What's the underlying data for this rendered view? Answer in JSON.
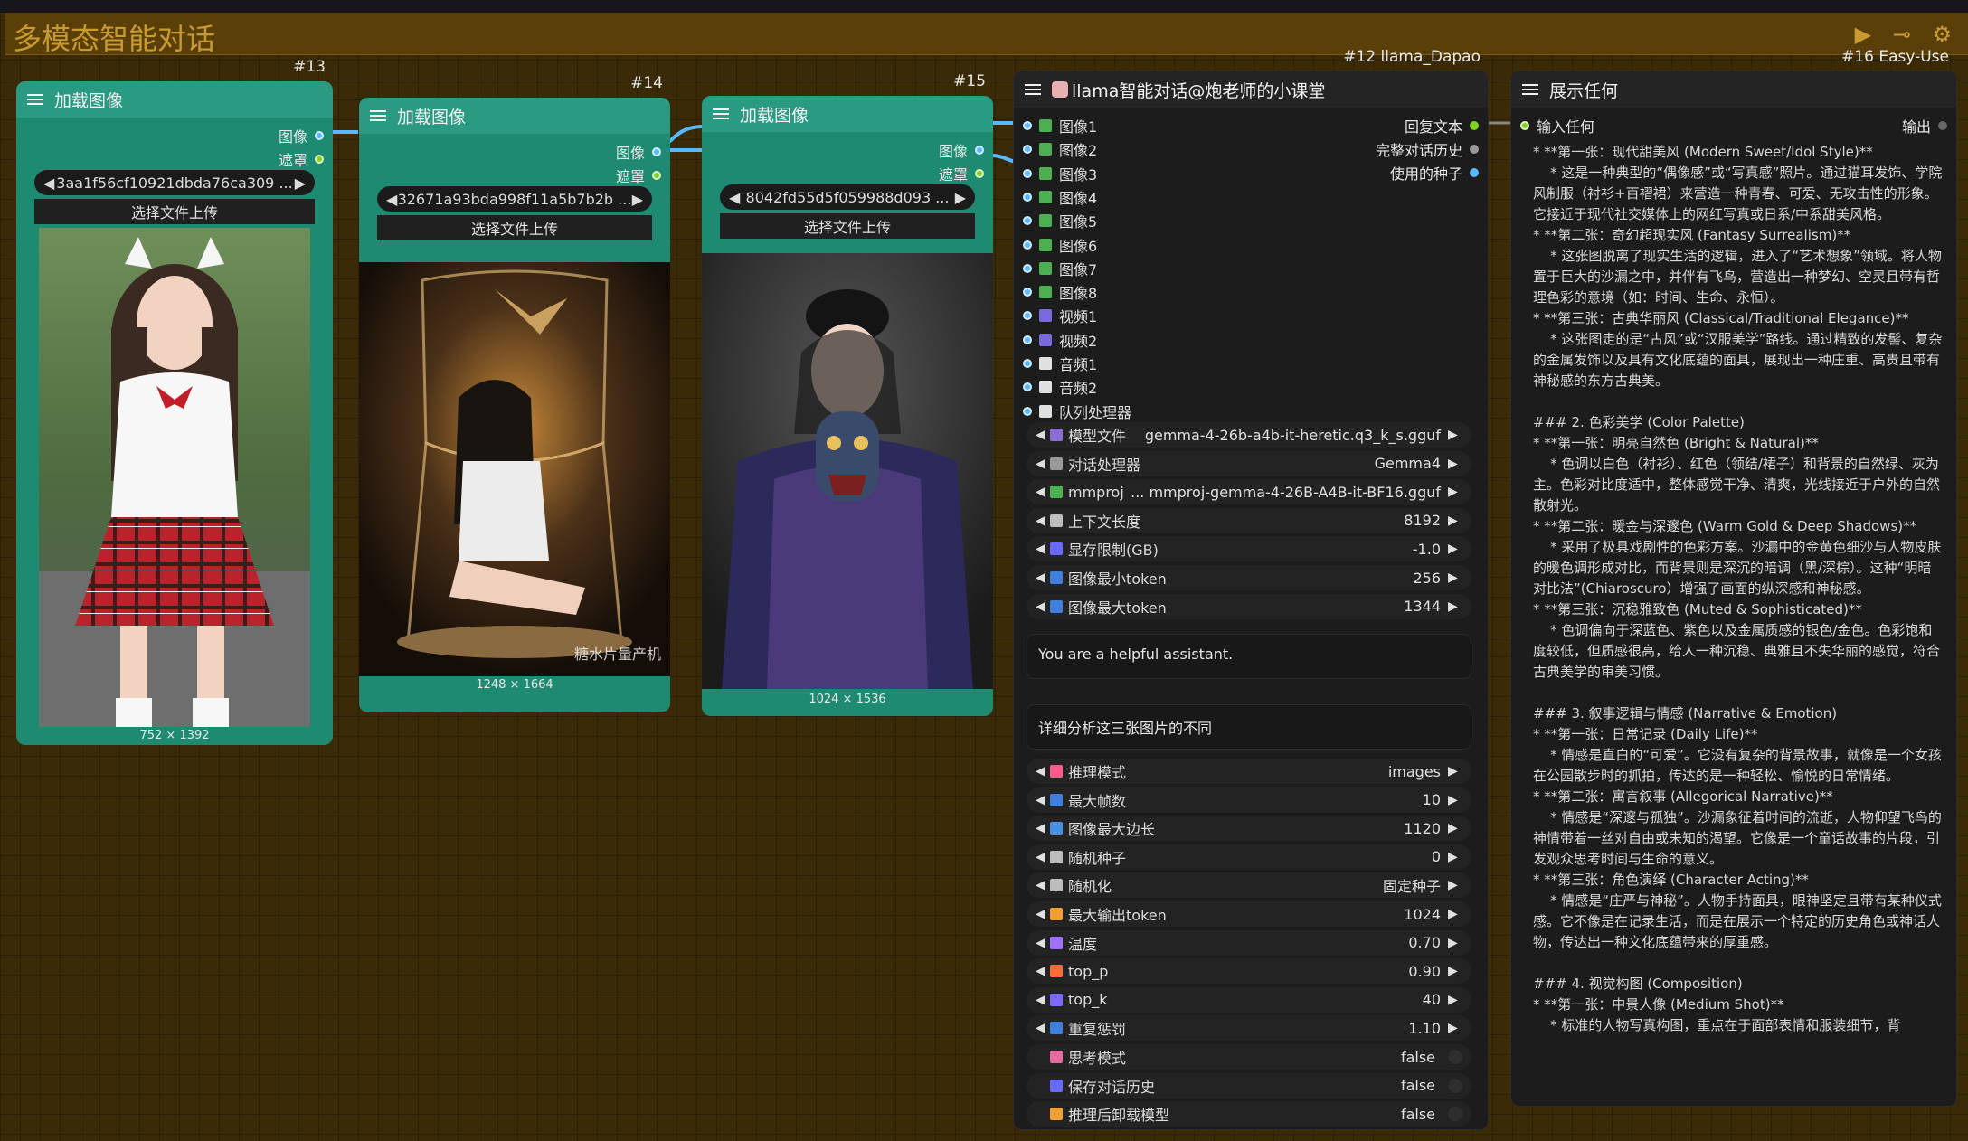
{
  "group": {
    "title": "多模态智能对话",
    "icons": "▶ ⊸ ⚙"
  },
  "load_nodes": [
    {
      "id": "#13",
      "title": "加载图像",
      "out_image": "图像",
      "out_mask": "遮罩",
      "file": "3aa1f56cf10921dbda76ca309 ...",
      "upload": "选择文件上传",
      "size": "752 × 1392"
    },
    {
      "id": "#14",
      "title": "加载图像",
      "out_image": "图像",
      "out_mask": "遮罩",
      "file": "32671a93bda998f11a5b7b2b ...",
      "upload": "选择文件上传",
      "size": "1248 × 1664",
      "watermark": "糖水片量产机"
    },
    {
      "id": "#15",
      "title": "加载图像",
      "out_image": "图像",
      "out_mask": "遮罩",
      "file": "8042fd55d5f059988d093 ...",
      "upload": "选择文件上传",
      "size": "1024 × 1536"
    }
  ],
  "llama": {
    "id": "#12 llama_Dapao",
    "title": "llama智能对话@炮老师的小课堂",
    "inputs": [
      "图像1",
      "图像2",
      "图像3",
      "图像4",
      "图像5",
      "图像6",
      "图像7",
      "图像8",
      "视频1",
      "视频2",
      "音频1",
      "音频2",
      "队列处理器"
    ],
    "outputs": [
      "回复文本",
      "完整对话历史",
      "使用的种子"
    ],
    "widgets_top": [
      {
        "label": "模型文件",
        "value": "gemma-4-26b-a4b-it-heretic.q3_k_s.gguf",
        "icon": "#8b6bd6"
      },
      {
        "label": "对话处理器",
        "value": "Gemma4",
        "icon": "#999999"
      },
      {
        "label": "mmproj",
        "value": "... mmproj-gemma-4-26B-A4B-it-BF16.gguf",
        "icon": "#4caf50"
      },
      {
        "label": "上下文长度",
        "value": "8192",
        "icon": "#bdbdbd"
      },
      {
        "label": "显存限制(GB)",
        "value": "-1.0",
        "icon": "#6a6aff"
      },
      {
        "label": "图像最小token",
        "value": "256",
        "icon": "#3f7fe0"
      },
      {
        "label": "图像最大token",
        "value": "1344",
        "icon": "#3f7fe0"
      }
    ],
    "system_prompt": "You are a helpful assistant.",
    "user_prompt": "详细分析这三张图片的不同",
    "widgets_bottom": [
      {
        "label": "推理模式",
        "value": "images",
        "icon": "#ff5a8a"
      },
      {
        "label": "最大帧数",
        "value": "10",
        "icon": "#3f7fe0"
      },
      {
        "label": "图像最大边长",
        "value": "1120",
        "icon": "#4a90e2"
      },
      {
        "label": "随机种子",
        "value": "0",
        "icon": "#bdbdbd"
      },
      {
        "label": "随机化",
        "value": "固定种子",
        "icon": "#bdbdbd"
      },
      {
        "label": "最大输出token",
        "value": "1024",
        "icon": "#f0a030"
      },
      {
        "label": "温度",
        "value": "0.70",
        "icon": "#a070ff"
      },
      {
        "label": "top_p",
        "value": "0.90",
        "icon": "#ff6a3a"
      },
      {
        "label": "top_k",
        "value": "40",
        "icon": "#7a6aff"
      },
      {
        "label": "重复惩罚",
        "value": "1.10",
        "icon": "#3f7fe0"
      }
    ],
    "toggles": [
      {
        "label": "思考模式",
        "value": "false",
        "icon": "#e86aa0"
      },
      {
        "label": "保存对话历史",
        "value": "false",
        "icon": "#6a6aff"
      },
      {
        "label": "推理后卸载模型",
        "value": "false",
        "icon": "#f0a030"
      }
    ]
  },
  "display": {
    "id": "#16 Easy-Use",
    "title": "展示任何",
    "input": "输入任何",
    "output": "输出",
    "text": "* **第一张：现代甜美风 (Modern Sweet/Idol Style)**\n    * 这是一种典型的“偶像感”或“写真感”照片。通过猫耳发饰、学院风制服（衬衫+百褶裙）来营造一种青春、可爱、无攻击性的形象。它接近于现代社交媒体上的网红写真或日系/中系甜美风格。\n* **第二张：奇幻超现实风 (Fantasy Surrealism)**\n    * 这张图脱离了现实生活的逻辑，进入了“艺术想象”领域。将人物置于巨大的沙漏之中，并伴有飞鸟，营造出一种梦幻、空灵且带有哲理色彩的意境（如：时间、生命、永恒）。\n* **第三张：古典华丽风 (Classical/Traditional Elegance)**\n    * 这张图走的是“古风”或“汉服美学”路线。通过精致的发髻、复杂的金属发饰以及具有文化底蕴的面具，展现出一种庄重、高贵且带有神秘感的东方古典美。\n\n### 2. 色彩美学 (Color Palette)\n* **第一张：明亮自然色 (Bright & Natural)**\n    * 色调以白色（衬衫）、红色（领结/裙子）和背景的自然绿、灰为主。色彩对比度适中，整体感觉干净、清爽，光线接近于户外的自然散射光。\n* **第二张：暖金与深邃色 (Warm Gold & Deep Shadows)**\n    * 采用了极具戏剧性的色彩方案。沙漏中的金黄色细沙与人物皮肤的暖色调形成对比，而背景则是深沉的暗调（黑/深棕）。这种“明暗对比法”(Chiaroscuro）增强了画面的纵深感和神秘感。\n* **第三张：沉稳雅致色 (Muted & Sophisticated)**\n    * 色调偏向于深蓝色、紫色以及金属质感的银色/金色。色彩饱和度较低，但质感很高，给人一种沉稳、典雅且不失华丽的感觉，符合古典美学的审美习惯。\n\n### 3. 叙事逻辑与情感 (Narrative & Emotion)\n* **第一张：日常记录 (Daily Life)**\n    * 情感是直白的“可爱”。它没有复杂的背景故事，就像是一个女孩在公园散步时的抓拍，传达的是一种轻松、愉悦的日常情绪。\n* **第二张：寓言叙事 (Allegorical Narrative)**\n    * 情感是“深邃与孤独”。沙漏象征着时间的流逝，人物仰望飞鸟的神情带着一丝对自由或未知的渴望。它像是一个童话故事的片段，引发观众思考时间与生命的意义。\n* **第三张：角色演绎 (Character Acting)**\n    * 情感是“庄严与神秘”。人物手持面具，眼神坚定且带有某种仪式感。它不像是在记录生活，而是在展示一个特定的历史角色或神话人物，传达出一种文化底蕴带来的厚重感。\n\n### 4. 视觉构图 (Composition)\n* **第一张：中景人像 (Medium Shot)**\n    * 标准的人物写真构图，重点在于面部表情和服装细节，背"
  }
}
